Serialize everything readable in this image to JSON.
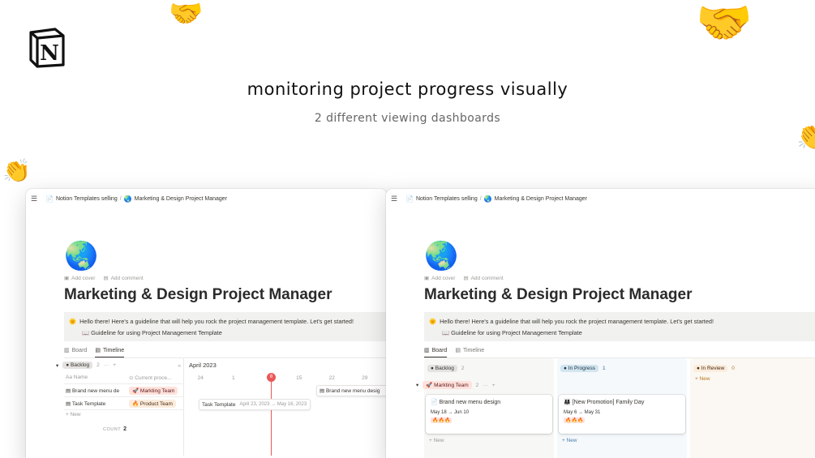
{
  "decor": {
    "logo_letter": "N",
    "emoji_a": "🤝",
    "emoji_b": "🤝",
    "emoji_c": "👏",
    "emoji_d": "👏"
  },
  "headline": "monitoring project progress visually",
  "subline": "2 different viewing dashboards",
  "breadcrumb": {
    "workspace": "Notion Templates selling",
    "separator": "/",
    "page": "Marketing & Design Project Manager"
  },
  "page": {
    "icon": "🌏",
    "add_cover": "Add cover",
    "add_comment": "Add comment",
    "title": "Marketing & Design Project Manager",
    "callout_emoji": "🌞",
    "callout_text": "Hello there! Here's a guideline that will help you rock the project management template. Let's get started!",
    "guideline_link": "📖 Guideline for using Project Management Template"
  },
  "tabs": {
    "board": "Board",
    "timeline": "Timeline"
  },
  "timeline": {
    "group": "Backlog",
    "group_count": "2",
    "col_name": "Name",
    "col_name_prefix": "Aa",
    "col_process": "Current proce...",
    "collapse": "«",
    "rows": [
      {
        "name": "Brand new menu de",
        "team": "🚀 Markting Team",
        "team_color": "red"
      },
      {
        "name": "Task Template",
        "team": "🔥 Product Team",
        "team_color": "yellow"
      }
    ],
    "new_label": "+ New",
    "count_label": "COUNT",
    "count_value": "2",
    "month": "April 2023",
    "days": [
      "24",
      "1",
      "8",
      "15",
      "22",
      "29"
    ],
    "today": "8",
    "bars": [
      {
        "name": "Brand new menu desig",
        "dates": ""
      },
      {
        "name": "Task Template",
        "dates": "April 23, 2023 → May 16, 2023"
      }
    ]
  },
  "board": {
    "columns": [
      {
        "label": "Backlog",
        "count": "2",
        "color": "gray"
      },
      {
        "label": "In Progress",
        "count": "1",
        "color": "blue"
      },
      {
        "label": "In Review",
        "count": "0",
        "color": "yellow"
      }
    ],
    "group": "🚀 Markting Team",
    "group_count": "2",
    "cards": [
      {
        "icon": "📄",
        "name": "Brand new menu design",
        "dates": "May 18 → Jun 10",
        "priority": "🔥🔥🔥"
      },
      {
        "icon": "👨‍👩‍👧",
        "name": "[New Promotion] Family Day",
        "dates": "May 6 → May 31",
        "priority": "🔥🔥🔥"
      }
    ],
    "new_label": "+ New"
  },
  "colors": {
    "today_red": "#eb5757",
    "page_bg": "#ffffff",
    "callout_bg": "#f1f1ef"
  }
}
